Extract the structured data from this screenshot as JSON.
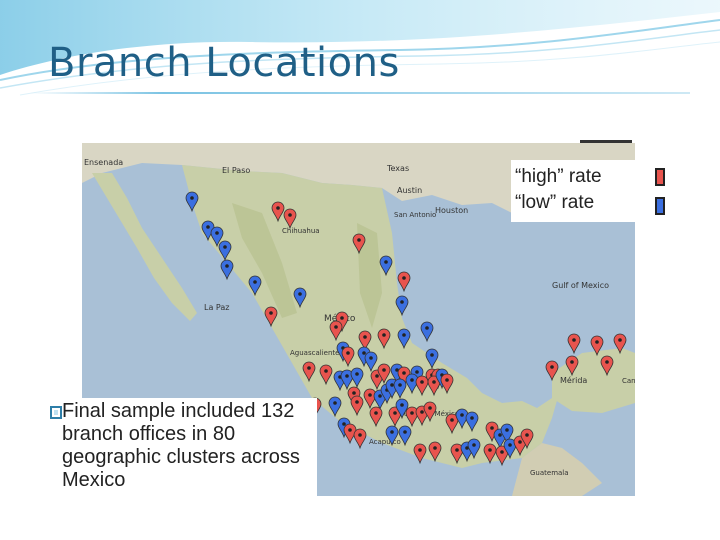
{
  "slide": {
    "title": "Branch Locations"
  },
  "legend": {
    "items": [
      {
        "label": "“high” rate",
        "color": "#e8544e"
      },
      {
        "label": "“low” rate",
        "color": "#3b6fe0"
      }
    ]
  },
  "bullet": {
    "text": "Final sample included 132 branch offices in 80 geographic clusters across Mexico"
  },
  "map": {
    "labels": [
      "Ensenada",
      "El Paso",
      "Texas",
      "Austin",
      "Houston",
      "San Antonio",
      "Chihuahua",
      "La Paz",
      "Gulf of Mexico",
      "México",
      "Aguascalientes",
      "Mérida",
      "Cancún",
      "Acapulco",
      "Guatemala",
      "Ciudad de México"
    ],
    "marker_colors": {
      "high": "#e8544e",
      "low": "#3b6fe0"
    }
  }
}
